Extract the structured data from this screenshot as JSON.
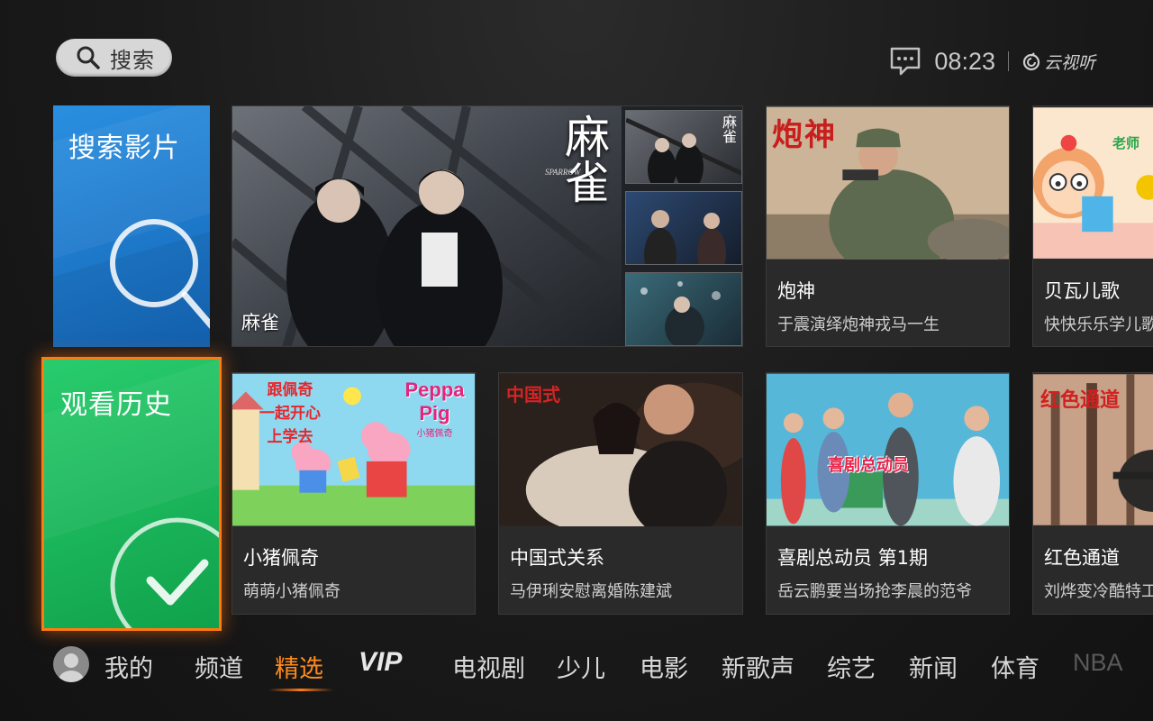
{
  "header": {
    "search_label": "搜索",
    "time": "08:23",
    "brand": "云视听"
  },
  "tiles": {
    "search_movies": "搜索影片",
    "watch_history": "观看历史"
  },
  "feature": {
    "title": "麻雀",
    "poster_text": "麻雀",
    "poster_sub": "SPARROW",
    "thumb_text": "麻雀"
  },
  "cards": [
    {
      "id": "paoshen",
      "title": "炮神",
      "desc": "于震演绎炮神戎马一生",
      "poster_text": "炮神"
    },
    {
      "id": "beiwa",
      "title": "贝瓦儿歌",
      "desc": "快快乐乐学儿歌",
      "poster_text": "老师"
    },
    {
      "id": "peppa",
      "title": "小猪佩奇",
      "desc": "萌萌小猪佩奇",
      "poster_lines": [
        "跟佩奇",
        "一起开心",
        "上学去"
      ],
      "logo": "Peppa Pig",
      "logo_sub": "小猪佩奇"
    },
    {
      "id": "zhongguoshi",
      "title": "中国式关系",
      "desc": "马伊琍安慰离婚陈建斌",
      "poster_text": "中国式"
    },
    {
      "id": "xiju",
      "title": "喜剧总动员 第1期",
      "desc": "岳云鹏要当场抢李晨的范爷",
      "poster_text": "喜剧总动员"
    },
    {
      "id": "hongse",
      "title": "红色通道",
      "desc": "刘烨变冷酷特工",
      "poster_text": "红色通道"
    }
  ],
  "nav": {
    "items": [
      "我的",
      "频道",
      "精选",
      "VIP",
      "电视剧",
      "少儿",
      "电影",
      "新歌声",
      "综艺",
      "新闻",
      "体育",
      "NBA"
    ],
    "active": "精选"
  },
  "colors": {
    "accent": "#ff7a10",
    "search_tile": "#1a78cc",
    "history_tile": "#1cb85c"
  },
  "icons": {
    "search": "search-icon",
    "message": "message-icon",
    "magnifier_deco": "magnifier-icon",
    "check_deco": "check-icon",
    "avatar": "user-icon"
  }
}
